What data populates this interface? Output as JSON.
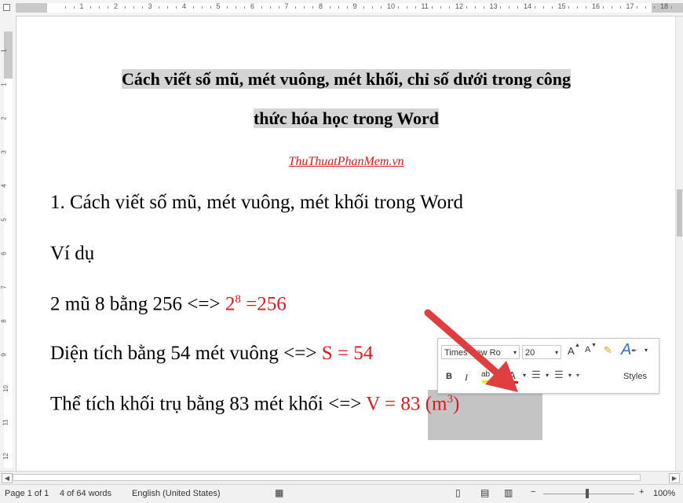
{
  "ruler": {
    "top_numbers": [
      "1",
      "2",
      "3",
      "4",
      "5",
      "6",
      "7",
      "8",
      "9",
      "10",
      "11",
      "12",
      "13",
      "14",
      "15",
      "16",
      "17",
      "18"
    ],
    "left_numbers": [
      "1",
      "1",
      "2",
      "3",
      "4",
      "5",
      "6",
      "7",
      "8",
      "9",
      "10",
      "11",
      "12"
    ]
  },
  "document": {
    "title_line1": "Cách viết số mũ, mét vuông, mét khối, chỉ số dưới trong công",
    "title_line2": "thức hóa học trong Word",
    "source": "ThuThuatPhanMem.vn",
    "heading1": "1. Cách viết số mũ, mét vuông, mét khối trong Word",
    "example_label": "Ví dụ",
    "line_power_text": " 2 mũ 8 bằng 256 <=> ",
    "line_power_base": "2",
    "line_power_exp": "8",
    "line_power_result": " =256",
    "line_area_text": "Diện tích bằng 54 mét vuông <=> ",
    "line_area_red": "S = 54",
    "line_volume_text": "Thể tích khối trụ bằng 83 mét khối <=> ",
    "line_volume_red": "V = 83 (m",
    "line_volume_exp": "3",
    "line_volume_close": ")"
  },
  "mini_toolbar": {
    "font_name": "Times New Ro",
    "font_size": "20",
    "bold_label": "B",
    "italic_label": "I",
    "font_color_label": "A",
    "styles_label": "Styles",
    "grow_font_label": "A",
    "shrink_font_label": "A"
  },
  "status": {
    "page": "Page 1 of 1",
    "words": "4 of 64 words",
    "language": "English (United States)",
    "zoom": "100%",
    "zoom_minus": "−",
    "zoom_plus": "+"
  },
  "colors": {
    "accent_red": "#e1161a",
    "arrow": "#e03e3e"
  }
}
